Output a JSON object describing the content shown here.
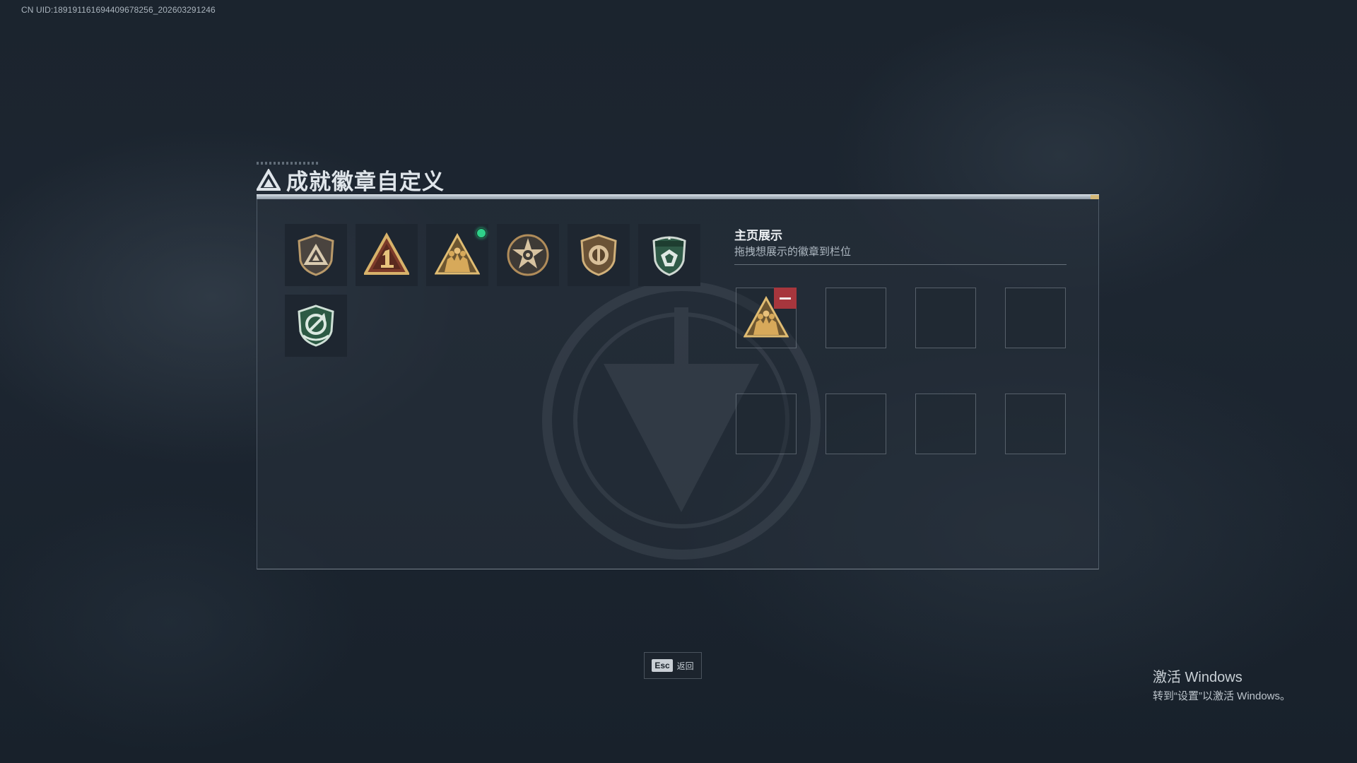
{
  "uid_text": "CN UID:189191161694409678256_202603291246",
  "title": "成就徽章自定义",
  "colors": {
    "accent_green": "#2fd18a",
    "remove_red": "#a7363d",
    "gold": "#c9a25d"
  },
  "badges": [
    {
      "icon": "triangle-shield-badge-icon",
      "selected": false
    },
    {
      "icon": "rank-one-triangle-badge-icon",
      "selected": false
    },
    {
      "icon": "squad-triangle-badge-icon",
      "selected": true
    },
    {
      "icon": "star-medal-badge-icon",
      "selected": false
    },
    {
      "icon": "emblem-shield-badge-icon",
      "selected": false
    },
    {
      "icon": "green-crest-badge-icon",
      "selected": false
    },
    {
      "icon": "green-cycle-shield-badge-icon",
      "selected": false
    }
  ],
  "showcase": {
    "title": "主页展示",
    "subtitle": "拖拽想展示的徽章到栏位",
    "slots": [
      {
        "filled": true,
        "icon": "squad-triangle-badge-icon"
      },
      {
        "filled": false
      },
      {
        "filled": false
      },
      {
        "filled": false
      },
      {
        "filled": false
      },
      {
        "filled": false
      },
      {
        "filled": false
      },
      {
        "filled": false
      }
    ]
  },
  "footer": {
    "esc_key": "Esc",
    "esc_label": "返回"
  },
  "windows_activation": {
    "title": "激活 Windows",
    "subtitle": "转到“设置”以激活 Windows。"
  }
}
